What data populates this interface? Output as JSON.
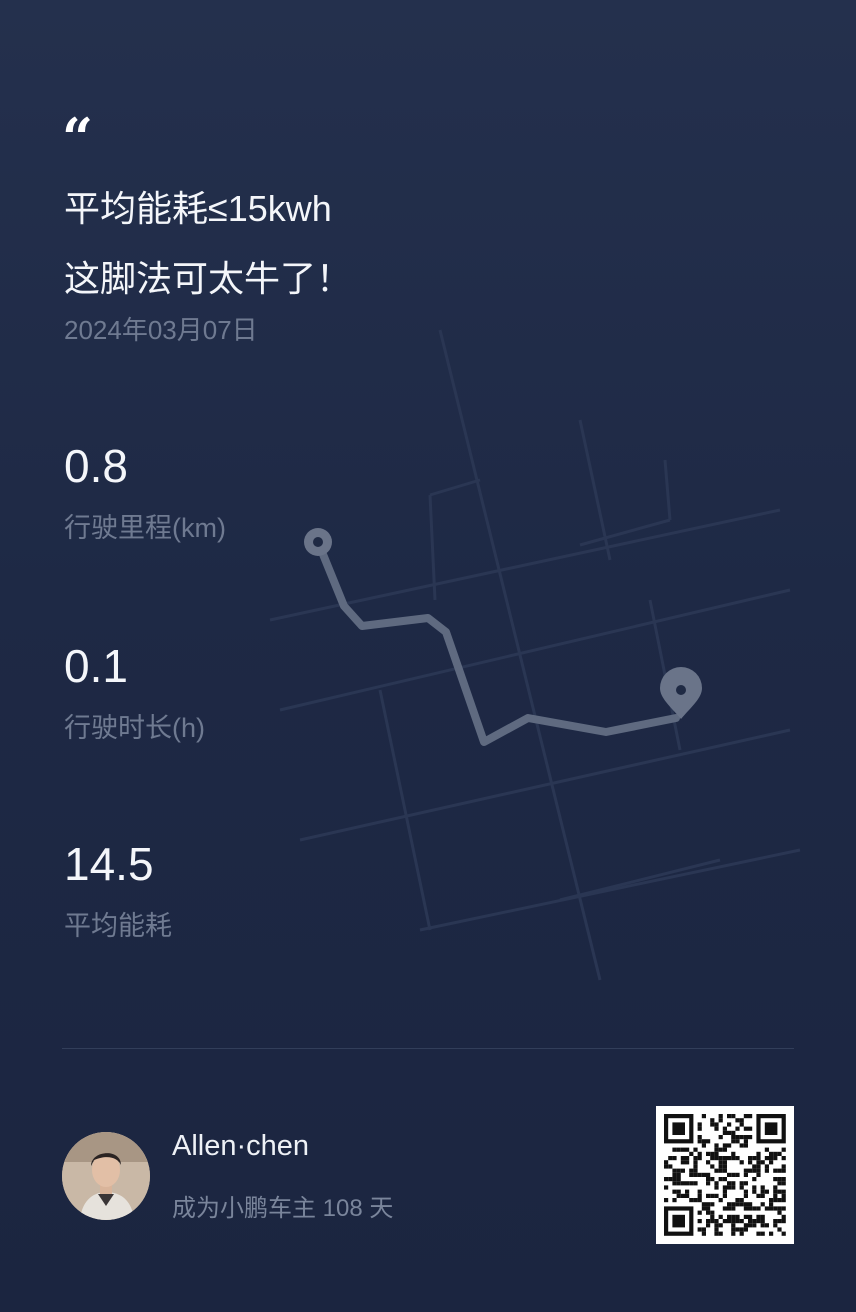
{
  "quote": {
    "mark": "“"
  },
  "headline": {
    "line1": "平均能耗≤15kwh",
    "line2": "这脚法可太牛了！"
  },
  "date": "2024年03月07日",
  "stats": [
    {
      "value": "0.8",
      "label": "行驶里程(km)"
    },
    {
      "value": "0.1",
      "label": "行驶时长(h)"
    },
    {
      "value": "14.5",
      "label": "平均能耗"
    }
  ],
  "user": {
    "name": "Allen·chen",
    "subtitle": "成为小鹏车主 108 天"
  },
  "colors": {
    "background": "#1f2a44",
    "text_primary": "#f4f6fa",
    "text_secondary": "#6f7a91",
    "route": "#5f6a80"
  },
  "icons": [
    "quote-icon",
    "route-start-pin-icon",
    "route-end-pin-icon",
    "qr-code-icon"
  ]
}
